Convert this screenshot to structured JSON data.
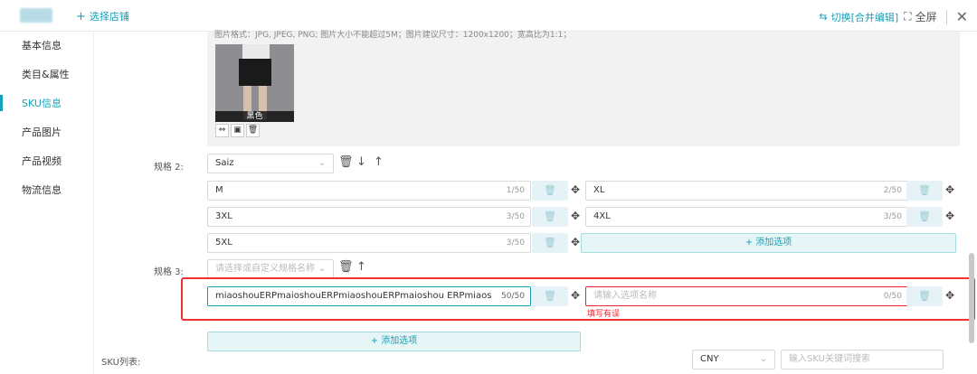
{
  "topbar": {
    "select_store": "选择店铺",
    "switch_label": "切换[合并编辑]",
    "fullscreen_label": "全屏"
  },
  "sidebar": {
    "items": [
      {
        "label": "基本信息"
      },
      {
        "label": "类目&属性"
      },
      {
        "label": "SKU信息"
      },
      {
        "label": "产品图片"
      },
      {
        "label": "产品视频"
      },
      {
        "label": "物流信息"
      }
    ],
    "active": "SKU信息"
  },
  "image_panel": {
    "hint": "图片格式：JPG, JPEG, PNG; 图片大小不能超过5M；图片建议尺寸：1200x1200；宽高比为1:1；",
    "thumb_label": "黑色"
  },
  "spec2": {
    "label": "规格 2:",
    "select_value": "Saiz",
    "options": [
      {
        "value": "M",
        "count": "1/50"
      },
      {
        "value": "XL",
        "count": "2/50"
      },
      {
        "value": "3XL",
        "count": "3/50"
      },
      {
        "value": "4XL",
        "count": "3/50"
      },
      {
        "value": "5XL",
        "count": "3/50"
      }
    ],
    "add_option": "+ 添加选项"
  },
  "spec3": {
    "label": "规格 3:",
    "select_placeholder": "请选择或自定义规格名称",
    "options": [
      {
        "value": "miaoshouERPmaioshouERPmiaoshouERPmaioshou ERPmiaos",
        "count": "50/50"
      },
      {
        "placeholder": "请输入选项名称",
        "count": "0/50",
        "error": "填写有误"
      }
    ],
    "add_option": "+ 添加选项"
  },
  "sku_list": {
    "label": "SKU列表:",
    "currency": "CNY",
    "search_placeholder": "输入SKU关键词搜索"
  },
  "colors": {
    "accent": "#14a2b8",
    "error": "#f5222d"
  }
}
